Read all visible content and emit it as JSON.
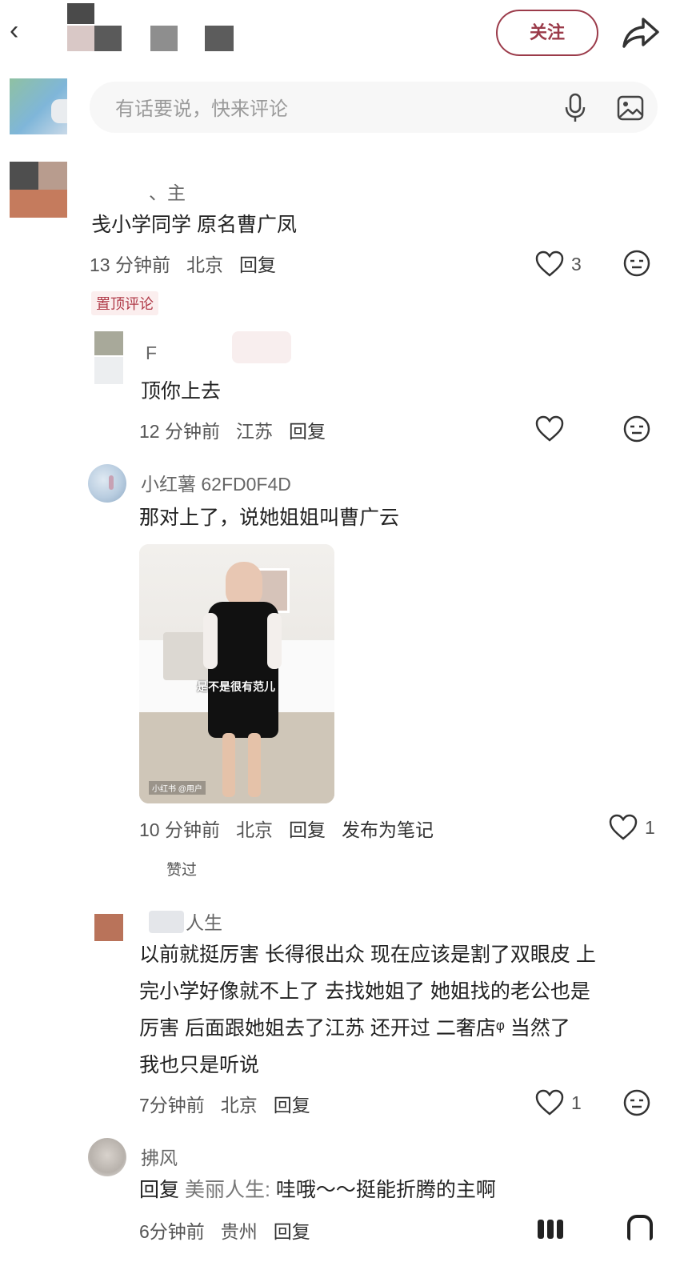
{
  "header": {
    "back_glyph": "‹",
    "follow_label": "关注"
  },
  "composer": {
    "placeholder": "有话要说，快来评论"
  },
  "icons": [
    "back-icon",
    "share-icon",
    "mic-icon",
    "image-icon",
    "heart-icon",
    "emoji-icon"
  ],
  "comments": [
    {
      "username": "、主",
      "text": "戋小学同学 原名曹广凤",
      "time": "13 分钟前",
      "location": "北京",
      "reply_label": "回复",
      "likes": "3",
      "badge": "置顶评论"
    },
    {
      "username": "F",
      "text": "顶你上去",
      "time": "12 分钟前",
      "location": "江苏",
      "reply_label": "回复",
      "likes": ""
    },
    {
      "username": "小红薯 62FD0F4D",
      "text": "那对上了，说她姐姐叫曹广云",
      "photo_caption": "是不是很有范儿",
      "photo_watermark": "小红书 @用户",
      "time": "10 分钟前",
      "location": "北京",
      "reply_label": "回复",
      "note_label": "发布为笔记",
      "likes": "1",
      "liked_by": "赞过"
    },
    {
      "username": "人生",
      "lines": [
        "以前就挺厉害 长得很出众 现在应该是割了双眼皮 上",
        "完小学好像就不上了 去找她姐了 她姐找的老公也是",
        "厉害 后面跟她姐去了江苏 还开过 二奢店ᵠ 当然了",
        "我也只是听说"
      ],
      "time": "7分钟前",
      "location": "北京",
      "reply_label": "回复",
      "likes": "1"
    },
    {
      "username": "拂风",
      "reply_prefix": "回复",
      "reply_to": "美丽人生:",
      "text": " 哇哦～～挺能折腾的主啊",
      "time": "6分钟前",
      "location": "贵州",
      "reply_label": "回复"
    }
  ]
}
